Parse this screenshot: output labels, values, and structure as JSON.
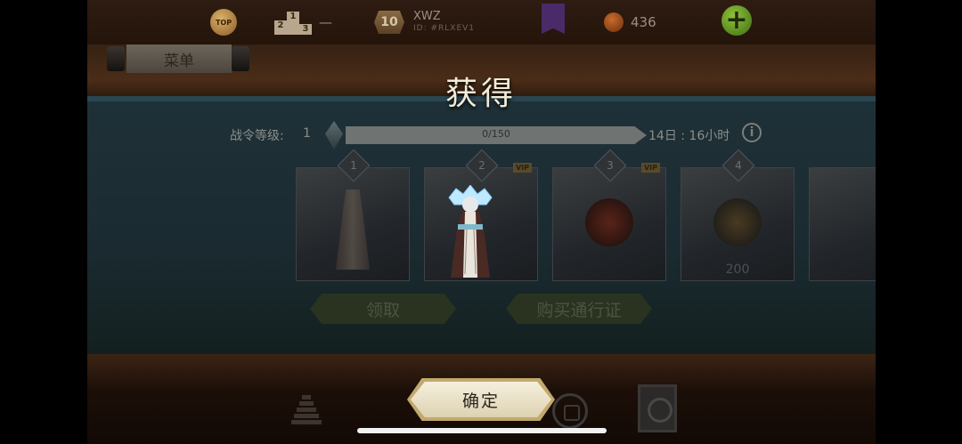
{
  "topbar": {
    "top_badge": "TOP",
    "podium": [
      "2",
      "1",
      "3"
    ],
    "rank_value": "—",
    "level": "10",
    "player_name": "XWZ",
    "player_id": "ID: #RLXEV1",
    "currency_amount": "436",
    "plus_label": "+"
  },
  "menu": {
    "label": "菜单"
  },
  "battlepass": {
    "rank_label": "战令等级:",
    "rank_value": "1",
    "xp_text": "0/150",
    "xp_fraction": 0,
    "time_left": "14日 : 16小时",
    "info_label": "i"
  },
  "cards": [
    {
      "num": "1",
      "vip": "",
      "qty": ""
    },
    {
      "num": "2",
      "vip": "VIP",
      "qty": ""
    },
    {
      "num": "3",
      "vip": "VIP",
      "qty": ""
    },
    {
      "num": "4",
      "vip": "",
      "qty": "200"
    }
  ],
  "buttons": {
    "claim": "领取",
    "buy_pass": "购买通行证"
  },
  "overlay": {
    "title": "获得",
    "confirm": "确定"
  },
  "colors": {
    "xp_fill": "#9ac24a",
    "confirm_bg": "#f5efdc",
    "plus_green": "#8fc23a"
  }
}
